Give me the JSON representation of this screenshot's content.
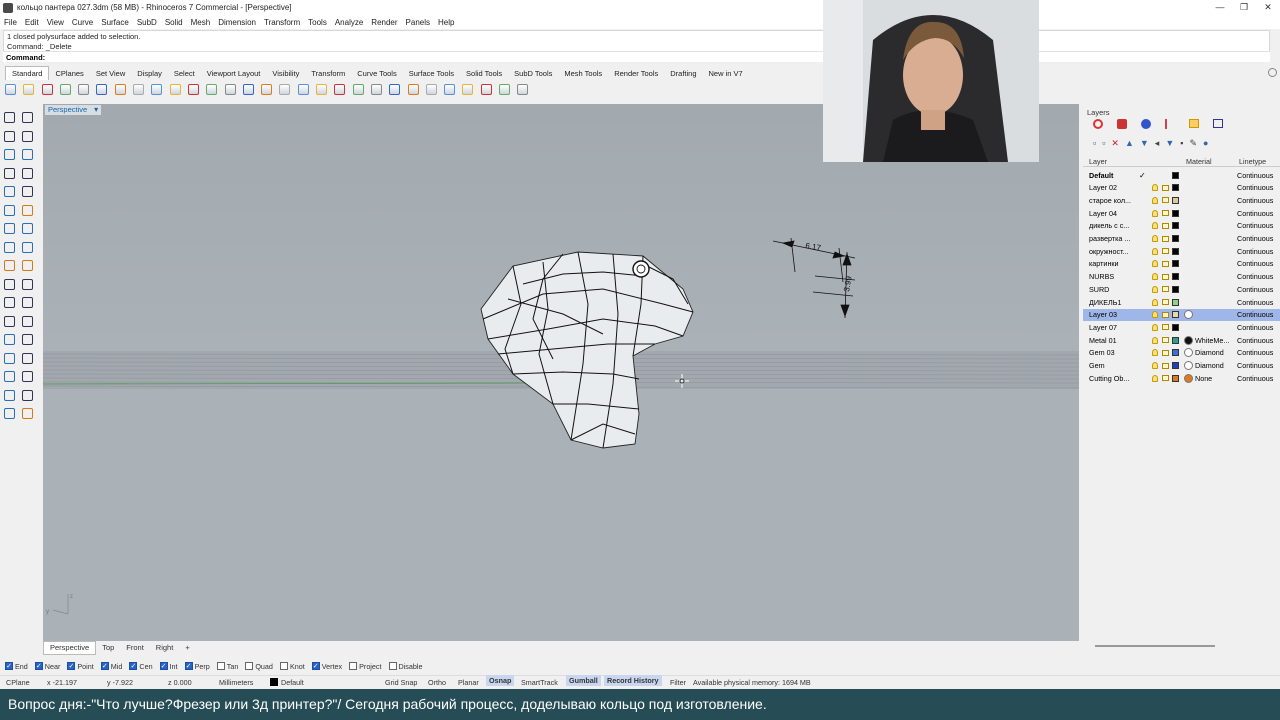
{
  "window": {
    "title": "кольцо пантера 027.3dm (58 MB) - Rhinoceros 7 Commercial - [Perspective]",
    "controls": [
      "—",
      "❐",
      "✕"
    ]
  },
  "menu": [
    "File",
    "Edit",
    "View",
    "Curve",
    "Surface",
    "SubD",
    "Solid",
    "Mesh",
    "Dimension",
    "Transform",
    "Tools",
    "Analyze",
    "Render",
    "Panels",
    "Help"
  ],
  "command_history": [
    "1 closed polysurface added to selection.",
    "Command: _Delete"
  ],
  "command_prompt": {
    "label": "Command:",
    "value": ""
  },
  "toolbar_tabs": [
    "Standard",
    "CPlanes",
    "Set View",
    "Display",
    "Select",
    "Viewport Layout",
    "Visibility",
    "Transform",
    "Curve Tools",
    "Surface Tools",
    "Solid Tools",
    "SubD Tools",
    "Mesh Tools",
    "Render Tools",
    "Drafting",
    "New in V7"
  ],
  "active_toolbar_tab": "Standard",
  "toolbar_icons": [
    "new-file-icon",
    "open-file-icon",
    "save-icon",
    "print-icon",
    "import-icon",
    "cut-icon",
    "copy-icon",
    "paste-icon",
    "undo-icon",
    "pan-icon",
    "rotate-view-icon",
    "zoom-icon",
    "zoom-window-icon",
    "zoom-extents-icon",
    "zoom-selected-icon",
    "layout-icon",
    "grid-icon",
    "cplane-icon",
    "snap-icon",
    "point-icon",
    "light-icon",
    "lock-icon",
    "car-icon",
    "color-icon",
    "render-sphere-icon",
    "material-sphere-icon",
    "environment-icon",
    "settings-icon",
    "help-icon"
  ],
  "viewport": {
    "label": "Perspective",
    "dim_horizontal": "6.17",
    "dim_vertical": "3.99",
    "axis_labels": {
      "z": "z",
      "y": "y",
      "x": "x"
    }
  },
  "viewport_tabs": [
    "Perspective",
    "Top",
    "Front",
    "Right",
    "+"
  ],
  "layers_panel": {
    "title": "Layers",
    "columns": {
      "layer": "Layer",
      "material": "Material",
      "linetype": "Linetype"
    },
    "rows": [
      {
        "name": "Default",
        "current": "✓",
        "color": "#000000",
        "material": "",
        "mat_color": "",
        "linetype": "Continuous",
        "bold": true
      },
      {
        "name": "Layer 02",
        "color": "#000000",
        "material": "",
        "mat_color": "",
        "linetype": "Continuous"
      },
      {
        "name": "старое кол...",
        "color": "#d8c9a0",
        "material": "",
        "mat_color": "",
        "linetype": "Continuous"
      },
      {
        "name": "Layer 04",
        "color": "#000000",
        "material": "",
        "mat_color": "",
        "linetype": "Continuous"
      },
      {
        "name": "дикель с с...",
        "color": "#000000",
        "material": "",
        "mat_color": "",
        "linetype": "Continuous"
      },
      {
        "name": "развертка ...",
        "color": "#000000",
        "material": "",
        "mat_color": "",
        "linetype": "Continuous"
      },
      {
        "name": "окружност...",
        "color": "#000000",
        "material": "",
        "mat_color": "",
        "linetype": "Continuous"
      },
      {
        "name": "картинки",
        "color": "#000000",
        "material": "",
        "mat_color": "",
        "linetype": "Continuous"
      },
      {
        "name": "NURBS",
        "color": "#000000",
        "material": "",
        "mat_color": "",
        "linetype": "Continuous"
      },
      {
        "name": "SURD",
        "color": "#000000",
        "material": "",
        "mat_color": "",
        "linetype": "Continuous"
      },
      {
        "name": "ДИКЕЛЬ1",
        "color": "#8fd18f",
        "material": "",
        "mat_color": "",
        "linetype": "Continuous"
      },
      {
        "name": "Layer 03",
        "color": "#e8d7a8",
        "material": "",
        "mat_color": "#ffffff",
        "linetype": "Continuous",
        "selected": true
      },
      {
        "name": "Layer 07",
        "color": "#000000",
        "material": "",
        "mat_color": "",
        "linetype": "Continuous"
      },
      {
        "name": "Metal 01",
        "color": "#2e9e8f",
        "material": "WhiteMe...",
        "mat_color": "#111111",
        "linetype": "Continuous"
      },
      {
        "name": "Gem 03",
        "color": "#3d6fd6",
        "material": "Diamond",
        "mat_color": "#ffffff",
        "linetype": "Continuous"
      },
      {
        "name": "Gem",
        "color": "#1f3fbf",
        "material": "Diamond",
        "mat_color": "#ffffff",
        "linetype": "Continuous"
      },
      {
        "name": "Cutting Ob...",
        "color": "#e07a20",
        "material": "None",
        "mat_color": "#e07a20",
        "linetype": "Continuous"
      }
    ]
  },
  "osnaps": [
    {
      "label": "End",
      "on": true
    },
    {
      "label": "Near",
      "on": true
    },
    {
      "label": "Point",
      "on": true
    },
    {
      "label": "Mid",
      "on": true
    },
    {
      "label": "Cen",
      "on": true
    },
    {
      "label": "Int",
      "on": true
    },
    {
      "label": "Perp",
      "on": true
    },
    {
      "label": "Tan",
      "on": false
    },
    {
      "label": "Quad",
      "on": false
    },
    {
      "label": "Knot",
      "on": false
    },
    {
      "label": "Vertex",
      "on": true
    },
    {
      "label": "Project",
      "on": false
    },
    {
      "label": "Disable",
      "on": false
    }
  ],
  "status": {
    "cplane": "CPlane",
    "x": "x -21.197",
    "y": "y -7.922",
    "z": "z 0.000",
    "units": "Millimeters",
    "layer": "Default",
    "grid_snap": "Grid Snap",
    "ortho": "Ortho",
    "planar": "Planar",
    "osnap": "Osnap",
    "smarttrack": "SmartTrack",
    "gumball": "Gumball",
    "record_history": "Record History",
    "filter": "Filter",
    "memory": "Available physical memory: 1694 MB"
  },
  "caption": "Вопрос дня:-\"Что лучше?Фрезер или 3д принтер?\"/ Сегодня рабочий процесс, доделываю кольцо под изготовление."
}
